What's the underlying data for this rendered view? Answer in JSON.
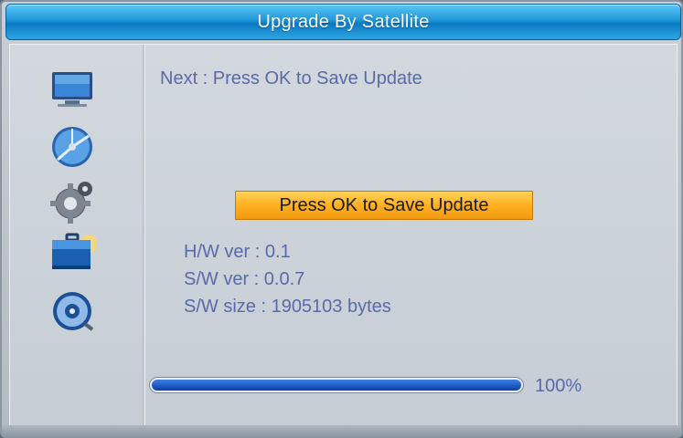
{
  "window": {
    "title": "Upgrade By Satellite"
  },
  "sidebar": {
    "items": [
      {
        "icon": "tv-monitor-icon"
      },
      {
        "icon": "satellite-dish-icon"
      },
      {
        "icon": "gear-icon"
      },
      {
        "icon": "toolbox-icon",
        "selected": true
      },
      {
        "icon": "media-disc-icon"
      }
    ]
  },
  "main": {
    "next_hint": "Next : Press OK to Save Update",
    "ok_button_label": "Press OK to Save Update",
    "hw_version": "H/W ver : 0.1",
    "sw_version": "S/W ver : 0.0.7",
    "sw_size": "S/W size : 1905103 bytes",
    "progress": {
      "value": 1.0,
      "label": "100%"
    }
  },
  "colors": {
    "accent": "#1f97d8",
    "button": "#ffb020",
    "text": "#5a6aa8",
    "progress": "#0c3fa8"
  }
}
